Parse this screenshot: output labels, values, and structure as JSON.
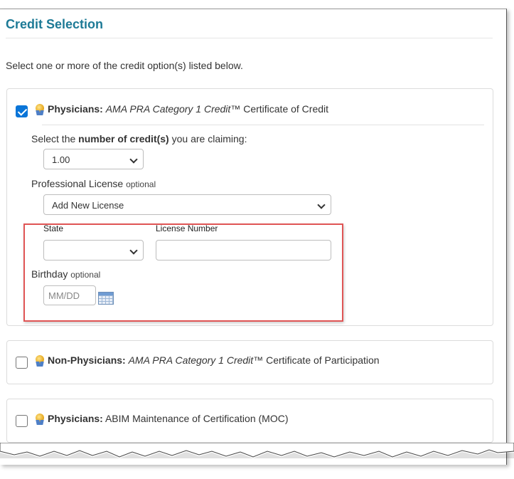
{
  "title": "Credit Selection",
  "intro": "Select one or more of the credit option(s) listed below.",
  "options": [
    {
      "checked": true,
      "bold": "Physicians:",
      "italic": "AMA PRA Category 1 Credit™",
      "rest": "Certificate of Credit"
    },
    {
      "checked": false,
      "bold": "Non-Physicians:",
      "italic": "AMA PRA Category 1 Credit™",
      "rest": "Certificate of Participation"
    },
    {
      "checked": false,
      "bold": "Physicians:",
      "italic": "",
      "rest": "ABIM Maintenance of Certification (MOC)"
    }
  ],
  "credit_form": {
    "credits_label_pre": "Select the",
    "credits_label_bold": "number of credit(s)",
    "credits_label_post": "you are claiming:",
    "credits_value": "1.00",
    "license_label": "Professional License",
    "license_optional": "optional",
    "license_value": "Add New License",
    "state_label": "State",
    "state_value": "",
    "license_number_label": "License Number",
    "license_number_value": "",
    "birthday_label": "Birthday",
    "birthday_optional": "optional",
    "birthday_placeholder": "MM/DD"
  },
  "icons": {
    "checkbox_checked": "checkbox-checked-icon",
    "award": "award-ribbon-icon",
    "calendar": "calendar-icon",
    "chevron": "chevron-down-icon"
  },
  "colors": {
    "title": "#1d7a96",
    "checkbox": "#0a75d8",
    "highlight": "#e05555"
  }
}
